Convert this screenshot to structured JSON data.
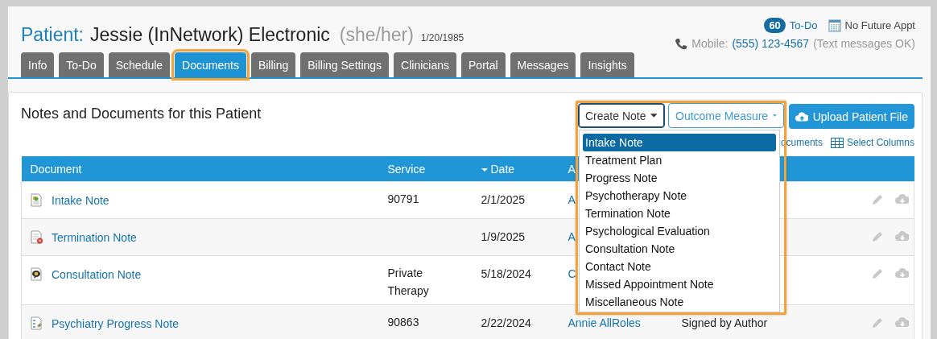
{
  "patient": {
    "label": "Patient:",
    "name": "Jessie (InNetwork) Electronic",
    "pronouns": "(she/her)",
    "dob": "1/20/1985"
  },
  "header_info": {
    "todo_count": "60",
    "todo_label": "To-Do",
    "appointment": "No Future Appt",
    "phone_label": "Mobile:",
    "phone": "(555) 123-4567",
    "phone_note": "(Text messages OK)"
  },
  "tabs": [
    {
      "label": "Info",
      "selected": false,
      "highlighted": false
    },
    {
      "label": "To-Do",
      "selected": false,
      "highlighted": false
    },
    {
      "label": "Schedule",
      "selected": false,
      "highlighted": false
    },
    {
      "label": "Documents",
      "selected": true,
      "highlighted": true
    },
    {
      "label": "Billing",
      "selected": false,
      "highlighted": false
    },
    {
      "label": "Billing Settings",
      "selected": false,
      "highlighted": false
    },
    {
      "label": "Clinicians",
      "selected": false,
      "highlighted": false
    },
    {
      "label": "Portal",
      "selected": false,
      "highlighted": false
    },
    {
      "label": "Messages",
      "selected": false,
      "highlighted": false
    },
    {
      "label": "Insights",
      "selected": false,
      "highlighted": false
    }
  ],
  "panel": {
    "title": "Notes and Documents for this Patient",
    "create_note": {
      "label": "Create Note",
      "expanded": true,
      "highlighted": true
    },
    "outcome_measure": {
      "label": "Outcome Measure"
    },
    "upload_button": "Upload Patient File",
    "documents_link": "ocuments",
    "select_columns": "Select Columns",
    "menu": [
      {
        "label": "Intake Note",
        "selected": true
      },
      {
        "label": "Treatment Plan",
        "selected": false
      },
      {
        "label": "Progress Note",
        "selected": false
      },
      {
        "label": "Psychotherapy Note",
        "selected": false
      },
      {
        "label": "Termination Note",
        "selected": false
      },
      {
        "label": "Psychological Evaluation",
        "selected": false
      },
      {
        "label": "Consultation Note",
        "selected": false
      },
      {
        "label": "Contact Note",
        "selected": false
      },
      {
        "label": "Missed Appointment Note",
        "selected": false
      },
      {
        "label": "Miscellaneous Note",
        "selected": false
      }
    ],
    "table": {
      "columns": [
        {
          "label": "Document",
          "sorted": false
        },
        {
          "label": "Service",
          "sorted": false
        },
        {
          "label": "Date",
          "sorted": true
        },
        {
          "label": "A",
          "sorted": false
        }
      ],
      "rows": [
        {
          "kind": "intake",
          "document": "Intake Note",
          "service": "90791",
          "date": "2/1/2025",
          "author": "A"
        },
        {
          "kind": "termination",
          "document": "Termination Note",
          "date": "1/9/2025",
          "author": "A"
        },
        {
          "kind": "consultation",
          "document": "Consultation Note",
          "service": "Private Therapy",
          "date": "5/18/2024",
          "author": "C"
        },
        {
          "kind": "psychiatry",
          "document": "Psychiatry Progress Note",
          "service": "90863",
          "date": "2/22/2024",
          "author": "Annie AllRoles",
          "status": "Signed by Author"
        }
      ]
    }
  }
}
